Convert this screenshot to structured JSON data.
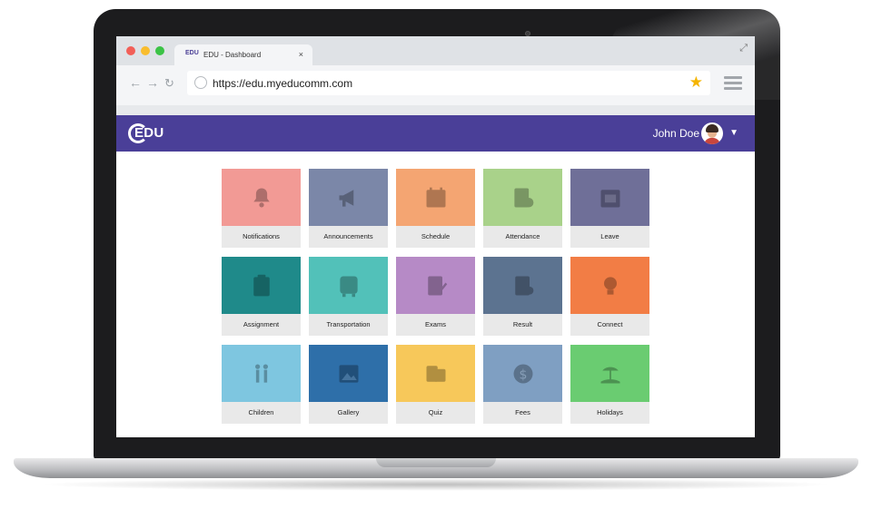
{
  "browser": {
    "tab_title": "EDU - Dashboard",
    "tab_close": "×",
    "favicon_text": "EDU",
    "url": "https://edu.myeducomm.com",
    "back": "←",
    "forward": "→",
    "reload": "↻",
    "bookmark": "★",
    "expand": "⤢"
  },
  "app": {
    "logo": "EDU",
    "user_name": "John Doe",
    "user_caret": "▼",
    "brand_color": "#4a3f98"
  },
  "tiles": [
    {
      "label": "Notifications",
      "color": "#f29a95",
      "icon": "bell-icon"
    },
    {
      "label": "Announcements",
      "color": "#7b87a8",
      "icon": "megaphone-icon"
    },
    {
      "label": "Schedule",
      "color": "#f4a572",
      "icon": "calendar-icon"
    },
    {
      "label": "Attendance",
      "color": "#a9d28a",
      "icon": "attendance-icon"
    },
    {
      "label": "Leave",
      "color": "#6f6f98",
      "icon": "leave-calendar-icon"
    },
    {
      "label": "Assignment",
      "color": "#1f8a8a",
      "icon": "clipboard-icon"
    },
    {
      "label": "Transportation",
      "color": "#52c1b9",
      "icon": "bus-icon"
    },
    {
      "label": "Exams",
      "color": "#b68ac6",
      "icon": "exam-icon"
    },
    {
      "label": "Result",
      "color": "#5c7390",
      "icon": "result-icon"
    },
    {
      "label": "Connect",
      "color": "#f27d45",
      "icon": "lightbulb-icon"
    },
    {
      "label": "Children",
      "color": "#7ec6e0",
      "icon": "children-icon"
    },
    {
      "label": "Gallery",
      "color": "#2e6fa9",
      "icon": "image-icon"
    },
    {
      "label": "Quiz",
      "color": "#f7c85a",
      "icon": "quiz-icon"
    },
    {
      "label": "Fees",
      "color": "#7f9fc2",
      "icon": "dollar-icon"
    },
    {
      "label": "Holidays",
      "color": "#6acc71",
      "icon": "beach-icon"
    }
  ]
}
